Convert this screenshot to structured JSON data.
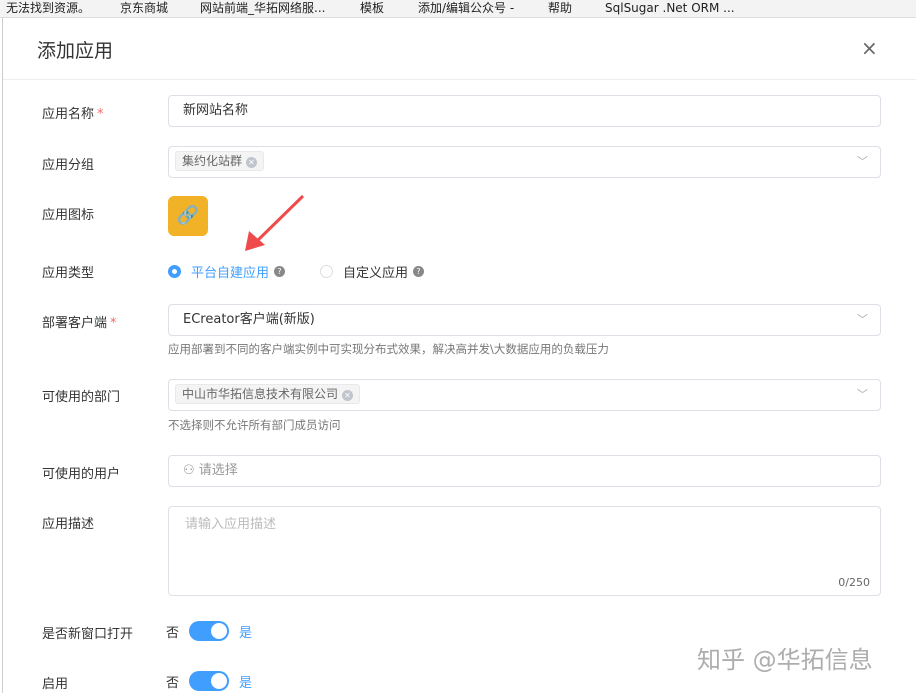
{
  "bookmarks": [
    "无法找到资源。",
    "京东商城",
    "网站前端_华拓网络服...",
    "模板",
    "添加/编辑公众号 -",
    "帮助",
    "SqlSugar .Net ORM ..."
  ],
  "dialog": {
    "title": "添加应用",
    "close": "×"
  },
  "form": {
    "name": {
      "label": "应用名称",
      "required": "*",
      "value": "新网站名称"
    },
    "group": {
      "label": "应用分组",
      "tag": "集约化站群"
    },
    "icon": {
      "label": "应用图标",
      "glyph": "link-icon"
    },
    "type": {
      "label": "应用类型",
      "options": [
        "平台自建应用",
        "自定义应用"
      ],
      "selected": "平台自建应用"
    },
    "client": {
      "label": "部署客户端",
      "required": "*",
      "value": "ECreator客户端(新版)",
      "hint": "应用部署到不同的客户端实例中可实现分布式效果，解决高并发\\大数据应用的负载压力"
    },
    "depts": {
      "label": "可使用的部门",
      "tag": "中山市华拓信息技术有限公司",
      "hint": "不选择则不允许所有部门成员访问"
    },
    "users": {
      "label": "可使用的用户",
      "placeholder": "请选择"
    },
    "desc": {
      "label": "应用描述",
      "placeholder": "请输入应用描述",
      "count": "0/250"
    },
    "newwin": {
      "label": "是否新窗口打开",
      "off": "否",
      "on": "是",
      "value": true
    },
    "enable": {
      "label": "启用",
      "off": "否",
      "on": "是",
      "value": true
    }
  },
  "watermark": "知乎 @华拓信息",
  "colors": {
    "primary": "#409eff",
    "icon_bg": "#f2b227",
    "arrow": "#ef4b4b"
  }
}
